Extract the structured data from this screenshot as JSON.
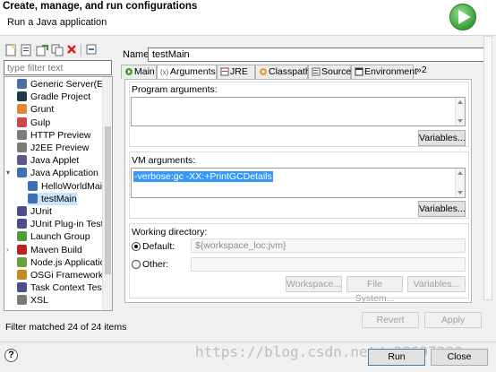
{
  "header": {
    "title": "Create, manage, and run configurations",
    "subtitle": "Run a Java application"
  },
  "left": {
    "filter_placeholder": "type filter text",
    "items": [
      {
        "label": "Generic Server(Exte",
        "icon": "server-icon",
        "color": "#4a6fa5"
      },
      {
        "label": "Gradle Project",
        "icon": "gradle-icon",
        "color": "#1d3a46"
      },
      {
        "label": "Grunt",
        "icon": "grunt-icon",
        "color": "#e48632"
      },
      {
        "label": "Gulp",
        "icon": "gulp-icon",
        "color": "#cf4647"
      },
      {
        "label": "HTTP Preview",
        "icon": "http-preview-icon",
        "color": "#7c7c7c"
      },
      {
        "label": "J2EE Preview",
        "icon": "j2ee-preview-icon",
        "color": "#7c7c7c"
      },
      {
        "label": "Java Applet",
        "icon": "java-applet-icon",
        "color": "#5a5a8a"
      },
      {
        "label": "Java Application",
        "icon": "java-application-icon",
        "color": "#3b6fb6"
      },
      {
        "label": "HelloWorldMain",
        "icon": "java-launch-icon",
        "color": "#3b6fb6"
      },
      {
        "label": "testMain",
        "icon": "java-launch-icon",
        "color": "#3b6fb6"
      },
      {
        "label": "JUnit",
        "icon": "junit-icon",
        "color": "#4d4d8d"
      },
      {
        "label": "JUnit Plug-in Test",
        "icon": "junit-plugin-icon",
        "color": "#4d4d8d"
      },
      {
        "label": "Launch Group",
        "icon": "launch-group-icon",
        "color": "#4f9c3f"
      },
      {
        "label": "Maven Build",
        "icon": "maven-icon",
        "color": "#b22"
      },
      {
        "label": "Node.js Applicatio",
        "icon": "nodejs-icon",
        "color": "#6a9f3d"
      },
      {
        "label": "OSGi Framework",
        "icon": "osgi-icon",
        "color": "#c28b1c"
      },
      {
        "label": "Task Context Test",
        "icon": "task-context-icon",
        "color": "#4d4d8d"
      },
      {
        "label": "XSL",
        "icon": "xsl-icon",
        "color": "#7a7a7a"
      }
    ],
    "status": "Filter matched 24 of 24 items"
  },
  "right": {
    "name_label": "Name:",
    "name_value": "testMain",
    "tabs": [
      {
        "label": "Main",
        "icon": "main-tab-icon"
      },
      {
        "label": "Arguments",
        "icon": "arguments-tab-icon"
      },
      {
        "label": "JRE",
        "icon": "jre-tab-icon"
      },
      {
        "label": "Classpath",
        "icon": "classpath-tab-icon"
      },
      {
        "label": "Source",
        "icon": "source-tab-icon"
      },
      {
        "label": "Environment",
        "icon": "environment-tab-icon"
      },
      {
        "label": "»2",
        "icon": "overflow-icon"
      }
    ],
    "program_args_label": "Program arguments:",
    "program_args_value": "",
    "variables_label": "Variables...",
    "vm_args_label": "VM arguments:",
    "vm_args_value": "-verbose:gc -XX:+PrintGCDetails",
    "working_dir_label": "Working directory:",
    "default_label": "Default:",
    "default_value": "${workspace_loc:jvm}",
    "other_label": "Other:",
    "workspace_btn": "Workspace...",
    "filesystem_btn": "File System...",
    "variables_btn": "Variables...",
    "revert_btn": "Revert",
    "apply_btn": "Apply"
  },
  "footer": {
    "help": "?",
    "run_btn": "Run",
    "close_btn": "Close",
    "watermark": "https://blog.csdn.net/_38697380"
  }
}
